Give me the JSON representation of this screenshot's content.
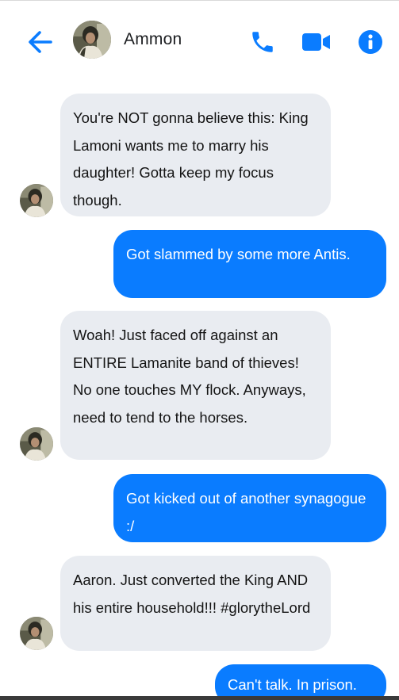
{
  "header": {
    "contact_name": "Ammon",
    "icons": {
      "back": "arrow-left-icon",
      "phone": "phone-icon",
      "video": "video-camera-icon",
      "info": "info-icon"
    },
    "accent_color": "#0a7cff"
  },
  "messages": [
    {
      "direction": "incoming",
      "text": "You're NOT gonna believe this: King Lamoni wants me to marry his daughter! Gotta keep my focus though."
    },
    {
      "direction": "outgoing",
      "text": "Got slammed by some more Antis."
    },
    {
      "direction": "incoming",
      "text": "Woah! Just faced off against an ENTIRE Lamanite band of thieves! No one touches MY flock. Anyways, need to tend to the horses."
    },
    {
      "direction": "outgoing",
      "text": "Got kicked out of another synagogue :/"
    },
    {
      "direction": "incoming",
      "text": "Aaron. Just converted the King AND his entire household!!! #glorytheLord"
    },
    {
      "direction": "outgoing",
      "text": "Can't talk. In prison."
    }
  ]
}
